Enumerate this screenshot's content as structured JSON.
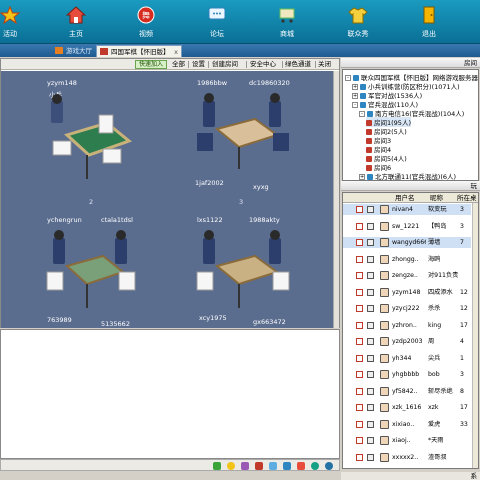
{
  "toolbar": {
    "items": [
      {
        "label": "活动",
        "icon": "star-icon"
      },
      {
        "label": "主页",
        "icon": "home-icon"
      },
      {
        "label": "视频",
        "icon": "video-icon"
      },
      {
        "label": "论坛",
        "icon": "chat-bubble-icon"
      },
      {
        "label": "商城",
        "icon": "shop-cart-icon"
      },
      {
        "label": "联众秀",
        "icon": "shirt-icon"
      },
      {
        "label": "退出",
        "icon": "exit-door-icon"
      }
    ]
  },
  "tabs": [
    {
      "label": "游戏大厅"
    },
    {
      "label": "四国军棋【怀旧版】",
      "close": "x"
    }
  ],
  "game_header": {
    "quick_join": "快速加入",
    "menu": [
      "全部",
      "设置",
      "创建房间",
      "安全中心",
      "绿色通道",
      "关闭"
    ]
  },
  "tables": [
    {
      "number": "",
      "top_left": "yzym148",
      "top_right": "",
      "side": "小兵",
      "bottom_left": "",
      "bottom_right": ""
    },
    {
      "number": "",
      "top_left": "1986bbw",
      "top_right": "dc19860320",
      "side": "",
      "bottom_left": "1jaf2002",
      "bottom_right": "xyxg"
    },
    {
      "number": "2",
      "top_left": "ychengrun",
      "top_right": "ctala1tdsl",
      "side": "",
      "bottom_left": "763989",
      "bottom_right": "5135662"
    },
    {
      "number": "3",
      "top_left": "lxs1122",
      "top_right": "1988akty",
      "side": "",
      "bottom_left": "xcy1975",
      "bottom_right": "gx663472"
    }
  ],
  "tree": {
    "header": "房间",
    "nodes": [
      {
        "label": "联众四国军棋【怀旧版】网络游戏服务器",
        "indent": 0,
        "exp": "-"
      },
      {
        "label": "小兵训练营(防区积分)(1071人)",
        "indent": 1,
        "exp": "+"
      },
      {
        "label": "军官对战(1536人)",
        "indent": 1,
        "exp": "+"
      },
      {
        "label": "官兵混战(110人)",
        "indent": 1,
        "exp": "-"
      },
      {
        "label": "南方电信16(官兵混战)(104人)",
        "indent": 2,
        "exp": "-"
      },
      {
        "label": "房间1(95人)",
        "indent": 3,
        "exp": ""
      },
      {
        "label": "房间2(5人)",
        "indent": 3,
        "exp": ""
      },
      {
        "label": "房间3",
        "indent": 3,
        "exp": ""
      },
      {
        "label": "房间4",
        "indent": 3,
        "exp": ""
      },
      {
        "label": "房间5(4人)",
        "indent": 3,
        "exp": ""
      },
      {
        "label": "房间6",
        "indent": 3,
        "exp": ""
      },
      {
        "label": "北方联通11(官兵混战)(6人)",
        "indent": 2,
        "exp": "+"
      }
    ]
  },
  "userlist": {
    "header": "玩",
    "columns": [
      "用户名",
      "昵称",
      "所在桌"
    ],
    "rows": [
      {
        "name": "nivan4",
        "nick": "软变玩",
        "table": "3",
        "hl": true
      },
      {
        "name": "sw_1221",
        "nick": "【鸭岛",
        "table": "3",
        "hl": false
      },
      {
        "name": "wangyd666",
        "nick": "薄墙",
        "table": "7",
        "hl": true
      },
      {
        "name": "zhongg..",
        "nick": "海鸥",
        "table": "",
        "hl": false
      },
      {
        "name": "zengze..",
        "nick": "对911负责",
        "table": "",
        "hl": false
      },
      {
        "name": "yzym148",
        "nick": "四成添水",
        "table": "12",
        "hl": false
      },
      {
        "name": "yzycj222",
        "nick": "杀杀",
        "table": "12",
        "hl": false
      },
      {
        "name": "yzhron..",
        "nick": "king",
        "table": "17",
        "hl": false
      },
      {
        "name": "yzdp2003",
        "nick": "周",
        "table": "4",
        "hl": false
      },
      {
        "name": "yh344",
        "nick": "尖兵",
        "table": "1",
        "hl": false
      },
      {
        "name": "yhgbbbb",
        "nick": "bob",
        "table": "3",
        "hl": false
      },
      {
        "name": "yf5842..",
        "nick": "斩尽杀绝",
        "table": "8",
        "hl": false
      },
      {
        "name": "xzk_1616",
        "nick": "xzk",
        "table": "17",
        "hl": false
      },
      {
        "name": "xixiao..",
        "nick": "爱虎",
        "table": "33",
        "hl": false
      },
      {
        "name": "xiaoj..",
        "nick": "*天雨",
        "table": "",
        "hl": false
      },
      {
        "name": "xxxxx2..",
        "nick": "渣哥叔",
        "table": "",
        "hl": false
      }
    ]
  },
  "right_footer": "系",
  "colors": {
    "toolbar": "#0b6f96",
    "game_bg": "#5b6d8f",
    "highlight": "#cfe0f5"
  }
}
